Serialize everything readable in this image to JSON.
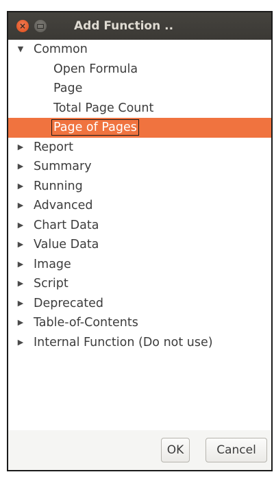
{
  "window": {
    "title": "Add Function .."
  },
  "tree": {
    "items": [
      {
        "label": "Common",
        "expanded": true,
        "children": [
          {
            "label": "Open Formula",
            "selected": false
          },
          {
            "label": "Page",
            "selected": false
          },
          {
            "label": "Total Page Count",
            "selected": false
          },
          {
            "label": "Page of Pages",
            "selected": true
          }
        ]
      },
      {
        "label": "Report",
        "expanded": false
      },
      {
        "label": "Summary",
        "expanded": false
      },
      {
        "label": "Running",
        "expanded": false
      },
      {
        "label": "Advanced",
        "expanded": false
      },
      {
        "label": "Chart Data",
        "expanded": false
      },
      {
        "label": "Value Data",
        "expanded": false
      },
      {
        "label": "Image",
        "expanded": false
      },
      {
        "label": "Script",
        "expanded": false
      },
      {
        "label": "Deprecated",
        "expanded": false
      },
      {
        "label": "Table-of-Contents",
        "expanded": false
      },
      {
        "label": "Internal Function (Do not use)",
        "expanded": false
      }
    ]
  },
  "buttons": {
    "ok": "OK",
    "cancel": "Cancel"
  },
  "colors": {
    "titlebar": "#3b3935",
    "close_button": "#df4a16",
    "selection": "#f0733f"
  },
  "icons": {
    "expanded": "▼",
    "collapsed": "▶",
    "close": "×"
  }
}
